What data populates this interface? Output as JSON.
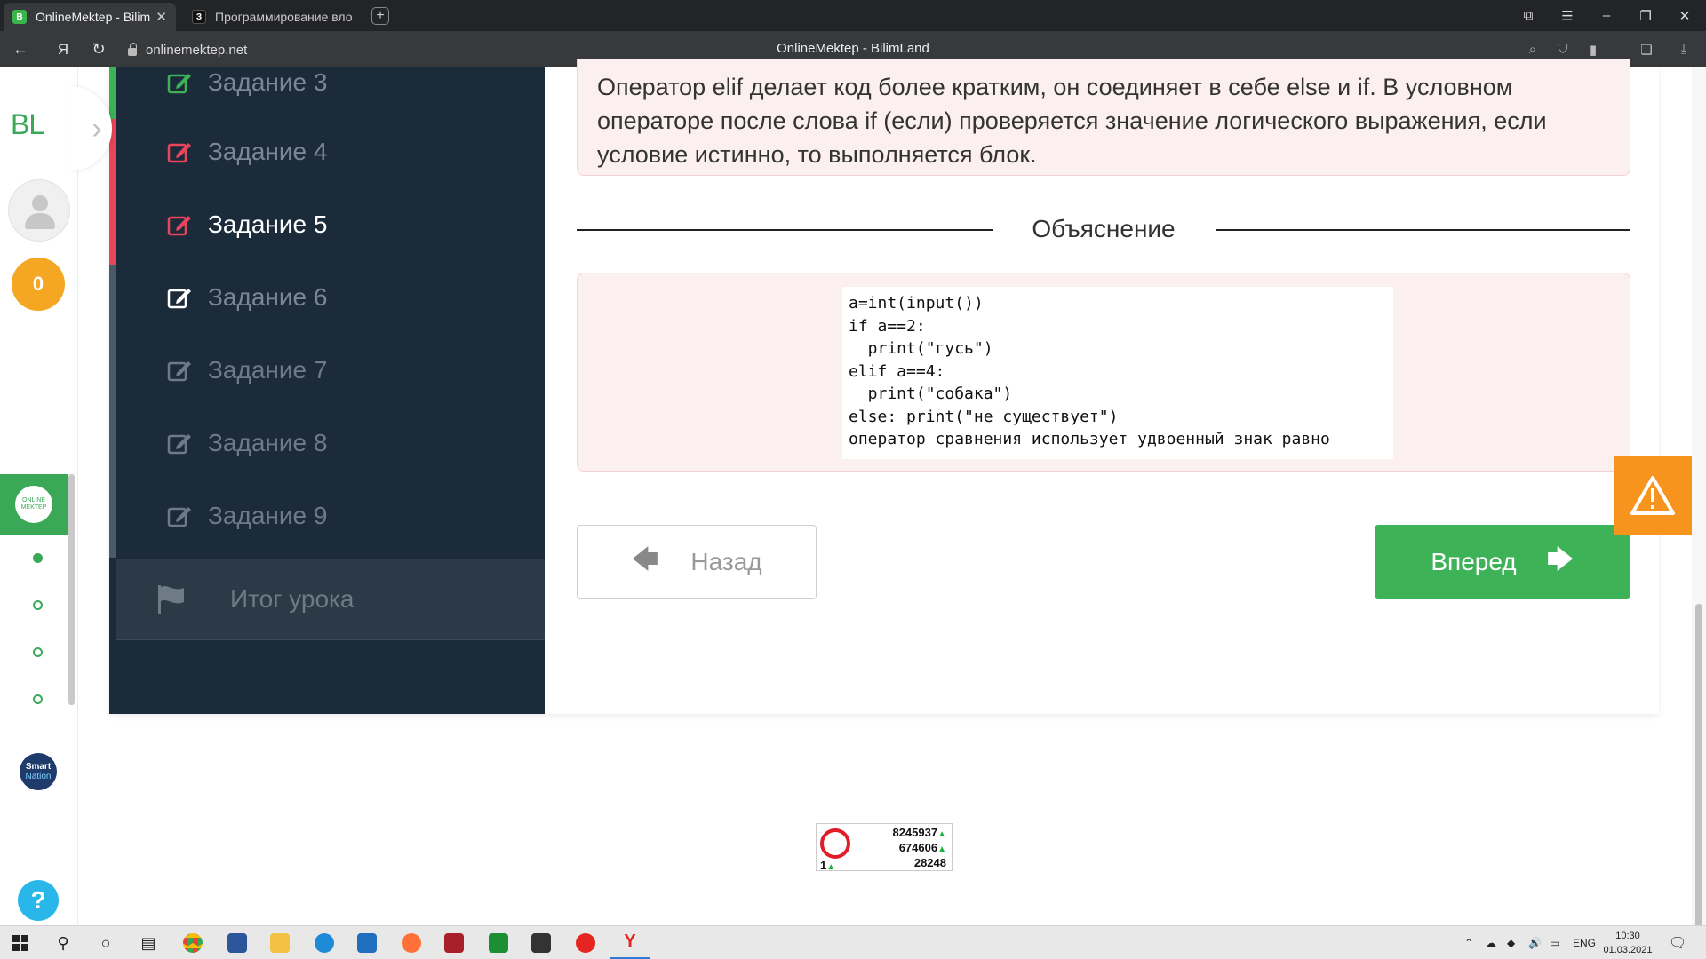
{
  "browser": {
    "tabs": [
      {
        "title": "OnlineMektep - BilimLand",
        "active": true,
        "favicon": "bilimland-favicon"
      },
      {
        "title": "Программирование вложе",
        "active": false,
        "favicon": "znanija-favicon"
      }
    ],
    "new_tab": "+",
    "url": "onlinemektep.net",
    "page_title": "OnlineMektep - BilimLand",
    "nav_icons": [
      "back-arrow-icon",
      "yandex-icon",
      "reload-icon",
      "lock-icon"
    ],
    "right_icons": [
      "translate-icon",
      "protect-icon",
      "bookmark-icon",
      "collections-icon",
      "download-icon"
    ]
  },
  "rail": {
    "logo": "BL",
    "expand": "›",
    "score": "0",
    "onlinemektep_badge": "ONLINE MEKTEP",
    "smart_top": "Smart",
    "smart_bottom": "Nation",
    "help": "?"
  },
  "lesson_nav": {
    "tasks": [
      {
        "label": "Задание 3",
        "status": "correct"
      },
      {
        "label": "Задание 4",
        "status": "wrong"
      },
      {
        "label": "Задание 5",
        "status": "wrong"
      },
      {
        "label": "Задание 6",
        "status": "current"
      },
      {
        "label": "Задание 7",
        "status": "pending"
      },
      {
        "label": "Задание 8",
        "status": "pending"
      },
      {
        "label": "Задание 9",
        "status": "pending"
      }
    ],
    "summary_label": "Итог урока"
  },
  "content": {
    "answer_text": "Оператор elif делает код более кратким, он соединяет в себе else и if. В условном операторе после слова if (если) проверяется значение логического выражения, если условие истинно, то выполняется блок.",
    "explanation_title": "Объяснение",
    "code": "a=int(input())\nif a==2:\n  print(\"гусь\")\nelif a==4:\n  print(\"собака\")\nelse: print(\"не существует\")\nоператор сравнения использует удвоенный знак равно",
    "back_label": "Назад",
    "next_label": "Вперед"
  },
  "counter": {
    "line1": "8245937",
    "line2": "674606",
    "line3": "28248",
    "left": "1"
  },
  "taskbar": {
    "lang": "ENG",
    "time": "10:30",
    "date": "01.03.2021"
  },
  "colors": {
    "green": "#3db256",
    "red": "#e9455c",
    "orange": "#f7941d",
    "navy": "#1c2b3a"
  }
}
